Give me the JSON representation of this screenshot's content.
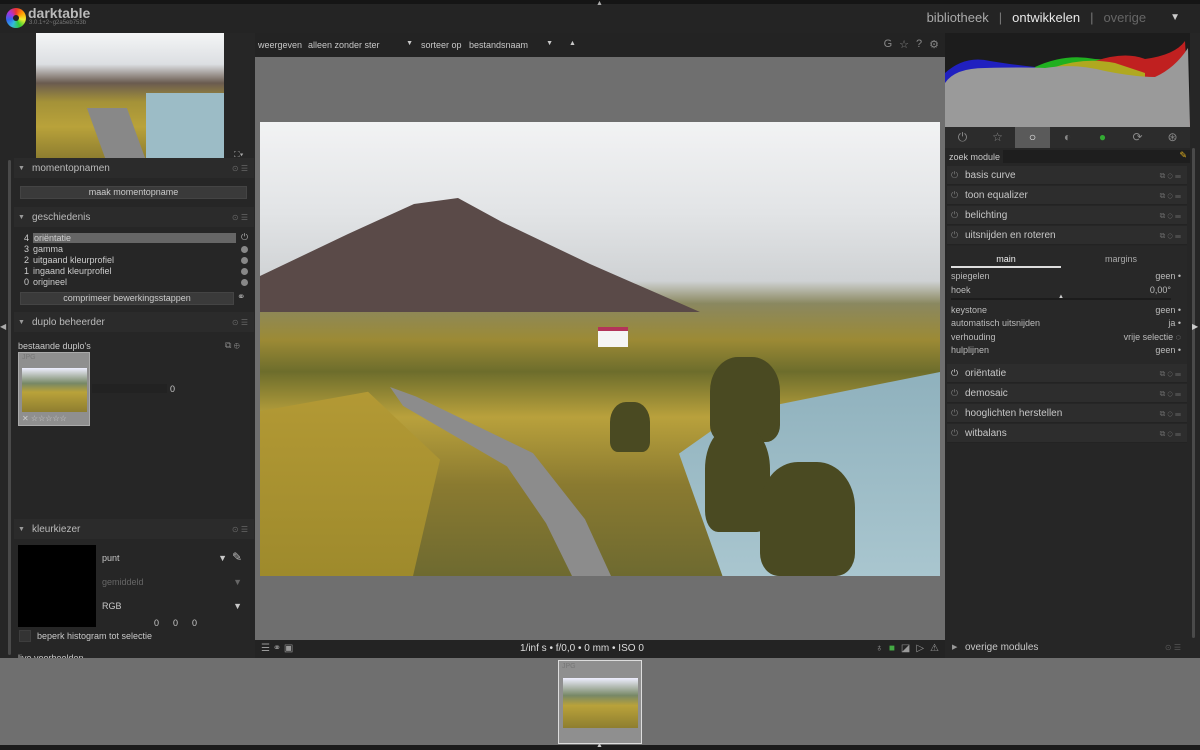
{
  "app": {
    "name": "darktable",
    "version": "3.0.1+2~g2a5eb753b"
  },
  "views": [
    {
      "label": "bibliotheek",
      "active": false
    },
    {
      "label": "ontwikkelen",
      "active": true
    },
    {
      "label": "overige",
      "active": false
    }
  ],
  "view_sep": "|",
  "left": {
    "snapshots": {
      "title": "momentopnamen",
      "button": "maak momentopname"
    },
    "history": {
      "title": "geschiedenis",
      "items": [
        {
          "n": "4",
          "label": "oriëntatie",
          "selected": true
        },
        {
          "n": "3",
          "label": "gamma"
        },
        {
          "n": "2",
          "label": "uitgaand kleurprofiel"
        },
        {
          "n": "1",
          "label": "ingaand kleurprofiel"
        },
        {
          "n": "0",
          "label": "origineel"
        }
      ],
      "compress": "comprimeer bewerkingsstappen"
    },
    "duplicates": {
      "title": "duplo beheerder",
      "label": "bestaande duplo's",
      "thumb_format": "JPG",
      "value": "0"
    },
    "colorpicker": {
      "title": "kleurkiezer",
      "mode": "punt",
      "stat": "gemiddeld",
      "space": "RGB",
      "values": [
        "0",
        "0",
        "0"
      ],
      "restrict": "beperk histogram tot selectie",
      "live": "live voorbeelden"
    }
  },
  "toolbar": {
    "show_label": "weergeven",
    "show_value": "alleen zonder ster",
    "sort_label": "sorteer op",
    "sort_value": "bestandsnaam",
    "icons": [
      "G",
      "☆",
      "?",
      "⚙"
    ]
  },
  "info": {
    "exif": "1/inf s • f/0,0 • 0 mm • ISO 0"
  },
  "right": {
    "tabs": [
      "⏻",
      "☆",
      "○",
      "◐",
      "●",
      "⟳",
      "⊛"
    ],
    "active_tab": 2,
    "search_label": "zoek module",
    "modules_top": [
      "basis curve",
      "toon equalizer",
      "belichting",
      "uitsnijden en roteren"
    ],
    "crop": {
      "tab_main": "main",
      "tab_margins": "margins",
      "params": [
        {
          "label": "spiegelen",
          "value": "geen •"
        },
        {
          "label": "hoek",
          "value": "0,00°"
        },
        {
          "label": "keystone",
          "value": "geen •"
        },
        {
          "label": "automatisch uitsnijden",
          "value": "ja •"
        },
        {
          "label": "verhouding",
          "value": "vrije selectie ◌"
        },
        {
          "label": "hulplijnen",
          "value": "geen •"
        }
      ]
    },
    "modules_bottom": [
      "oriëntatie",
      "demosaic",
      "hooglichten herstellen",
      "witbalans"
    ],
    "more": "overige modules"
  },
  "filmstrip": {
    "thumb_format": "JPG"
  },
  "colors": {
    "accent": "#ffffff",
    "panel": "#262626",
    "canvas": "#6f6f6f"
  }
}
